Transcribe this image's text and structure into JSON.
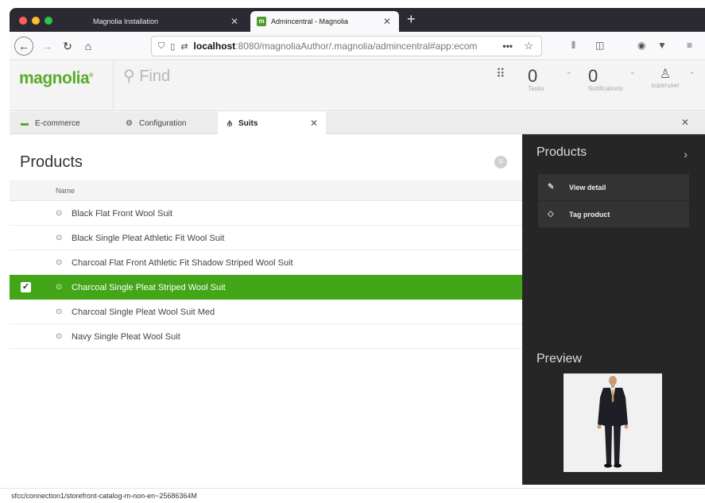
{
  "browser": {
    "tabs": [
      {
        "title": "Magnolia Installation",
        "active": false
      },
      {
        "title": "Admincentral - Magnolia",
        "active": true
      }
    ],
    "favicon_text": "m",
    "url": {
      "host": "localhost",
      "rest": ":8080/magnoliaAuthor/.magnolia/admincentral#app:ecom"
    },
    "url_menu": "•••"
  },
  "header": {
    "logo_text": "magnolia",
    "logo_mark": "®",
    "search_placeholder": "Find",
    "tasks": {
      "count": "0",
      "label": "Tasks"
    },
    "notifications": {
      "count": "0",
      "label": "Notifications"
    },
    "user_label": "superuser"
  },
  "app_tabs": [
    {
      "label": "E-commerce",
      "icon": "cart-icon"
    },
    {
      "label": "Configuration",
      "icon": "gear-icon"
    },
    {
      "label": "Suits",
      "icon": "hierarchy-icon",
      "active": true
    }
  ],
  "products": {
    "title": "Products",
    "column_header": "Name",
    "rows": [
      {
        "name": "Black Flat Front Wool Suit",
        "selected": false
      },
      {
        "name": "Black Single Pleat Athletic Fit Wool Suit",
        "selected": false
      },
      {
        "name": "Charcoal Flat Front Athletic Fit Shadow Striped Wool Suit",
        "selected": false
      },
      {
        "name": "Charcoal Single Pleat Striped Wool Suit",
        "selected": true
      },
      {
        "name": "Charcoal Single Pleat Wool Suit Med",
        "selected": false
      },
      {
        "name": "Navy Single Pleat Wool Suit",
        "selected": false
      }
    ]
  },
  "actionbar": {
    "title": "Products",
    "actions": [
      {
        "label": "View detail",
        "icon": "pencil-icon"
      },
      {
        "label": "Tag product",
        "icon": "tag-icon"
      }
    ],
    "preview_title": "Preview"
  },
  "status": {
    "path": "sfcc/connection1/storefront-catalog-m-non-en~25686364M"
  },
  "colors": {
    "brand_green": "#5aab2a",
    "selected_row": "#43a618",
    "actionbar_bg": "#262626"
  }
}
